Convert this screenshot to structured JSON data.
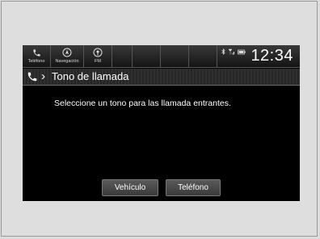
{
  "statusbar": {
    "shortcuts": [
      {
        "label": "Teléfono",
        "icon": "phone-icon"
      },
      {
        "label": "Navegación",
        "icon": "navigation-icon"
      },
      {
        "label": "FM",
        "icon": "radio-icon"
      }
    ],
    "clock": "12:34",
    "status_icons": [
      "bluetooth-icon",
      "signal-icon",
      "battery-icon"
    ]
  },
  "header": {
    "title": "Tono de llamada",
    "icon": "phone-icon"
  },
  "main": {
    "message": "Seleccione un tono para las llamada entrantes."
  },
  "buttons": {
    "vehicle": "Vehículo",
    "phone": "Teléfono"
  }
}
